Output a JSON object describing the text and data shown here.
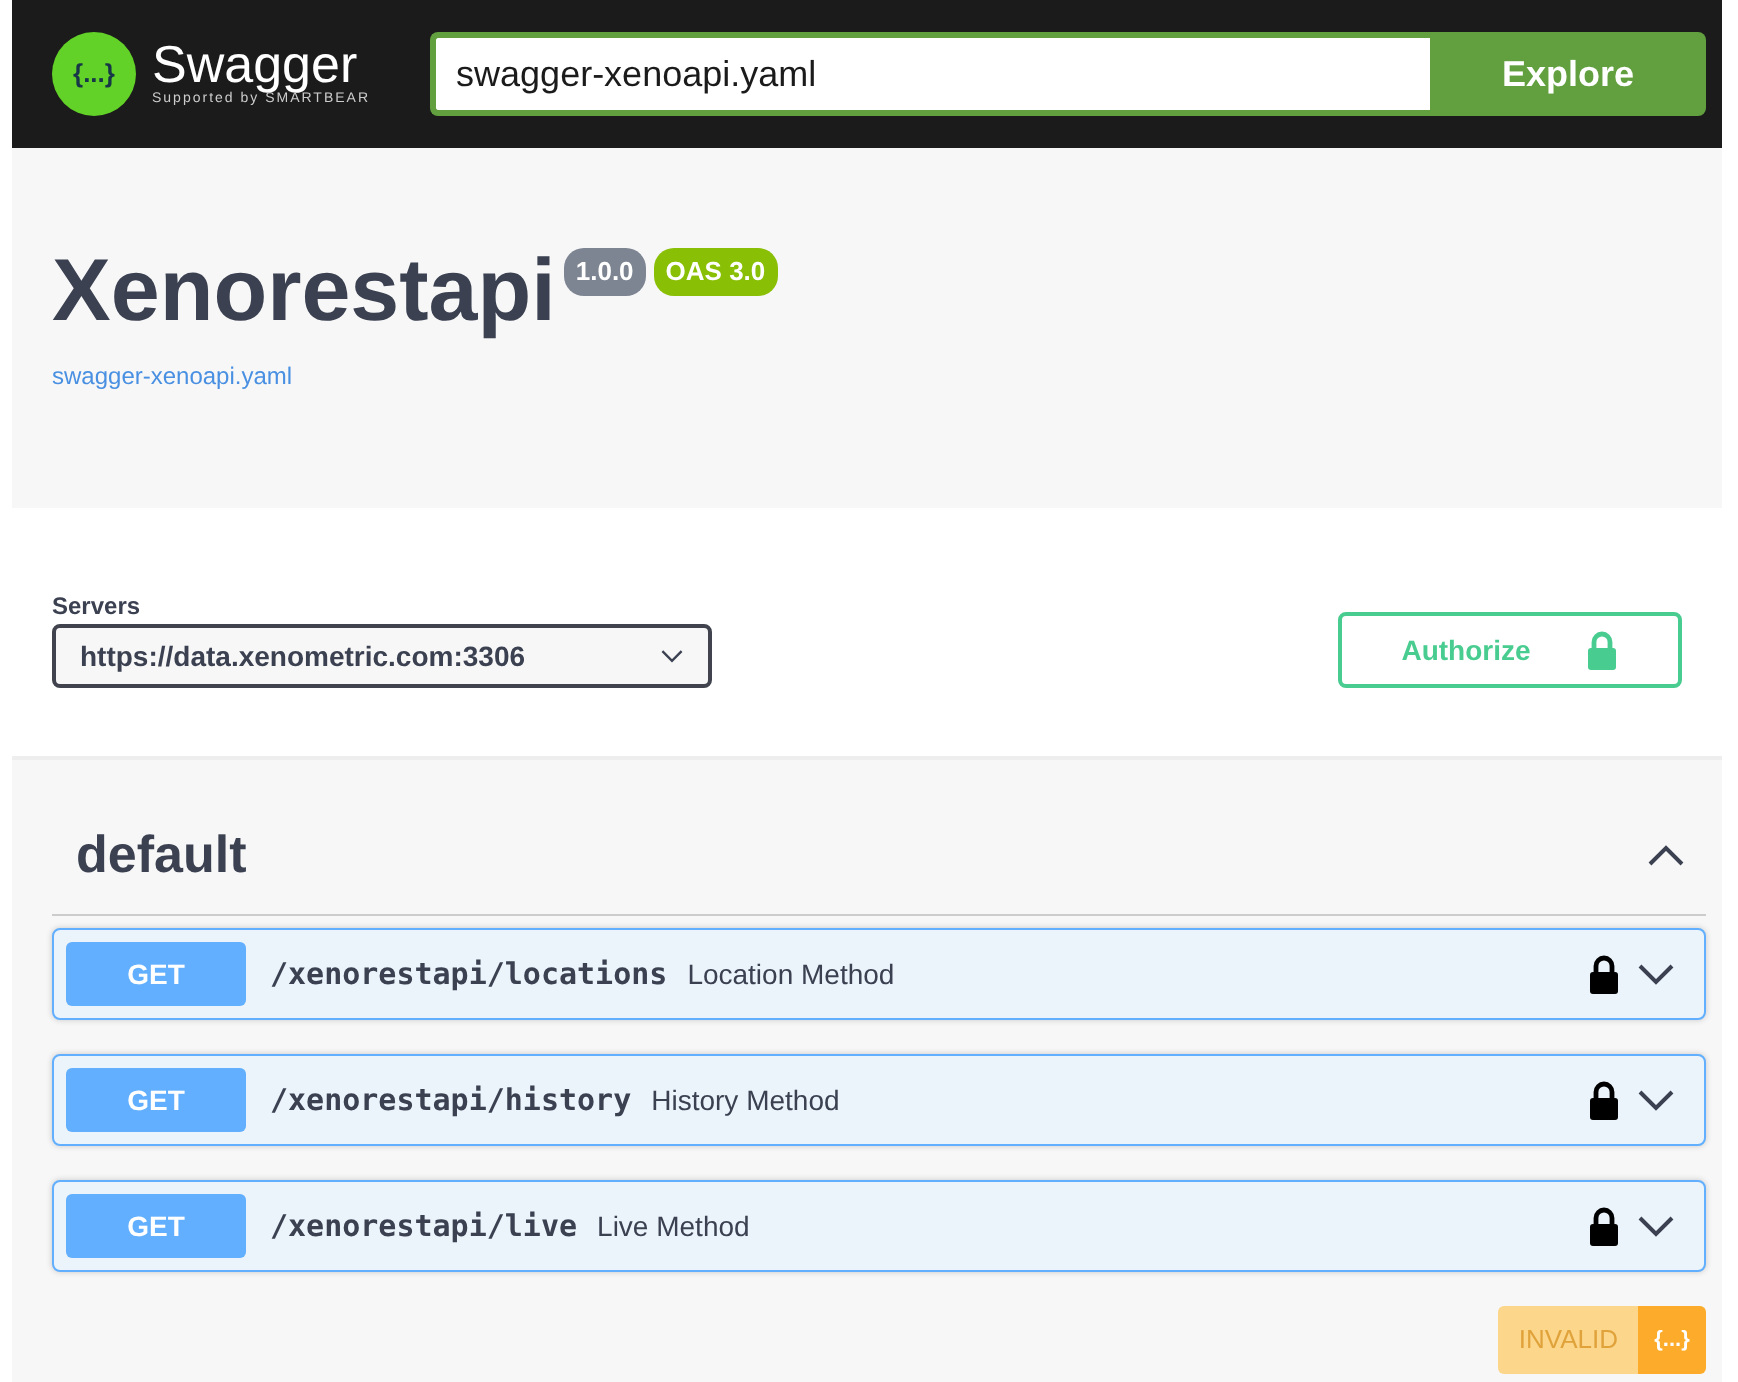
{
  "topbar": {
    "logo_glyph": "{...}",
    "brand": "Swagger",
    "tagline": "Supported by SMARTBEAR",
    "url": "swagger-xenoapi.yaml",
    "explore": "Explore"
  },
  "info": {
    "title": "Xenorestapi",
    "version": "1.0.0",
    "oas": "OAS 3.0",
    "link": "swagger-xenoapi.yaml"
  },
  "servers": {
    "label": "Servers",
    "selected": "https://data.xenometric.com:3306",
    "authorize": "Authorize"
  },
  "section": {
    "name": "default",
    "expanded": true,
    "operations": [
      {
        "method": "GET",
        "path": "/xenorestapi/locations",
        "summary": "Location Method",
        "locked": true,
        "expanded": false
      },
      {
        "method": "GET",
        "path": "/xenorestapi/history",
        "summary": "History Method",
        "locked": true,
        "expanded": false
      },
      {
        "method": "GET",
        "path": "/xenorestapi/live",
        "summary": "Live Method",
        "locked": true,
        "expanded": false
      }
    ]
  },
  "validator": {
    "text": "INVALID",
    "glyph": "{...}"
  }
}
